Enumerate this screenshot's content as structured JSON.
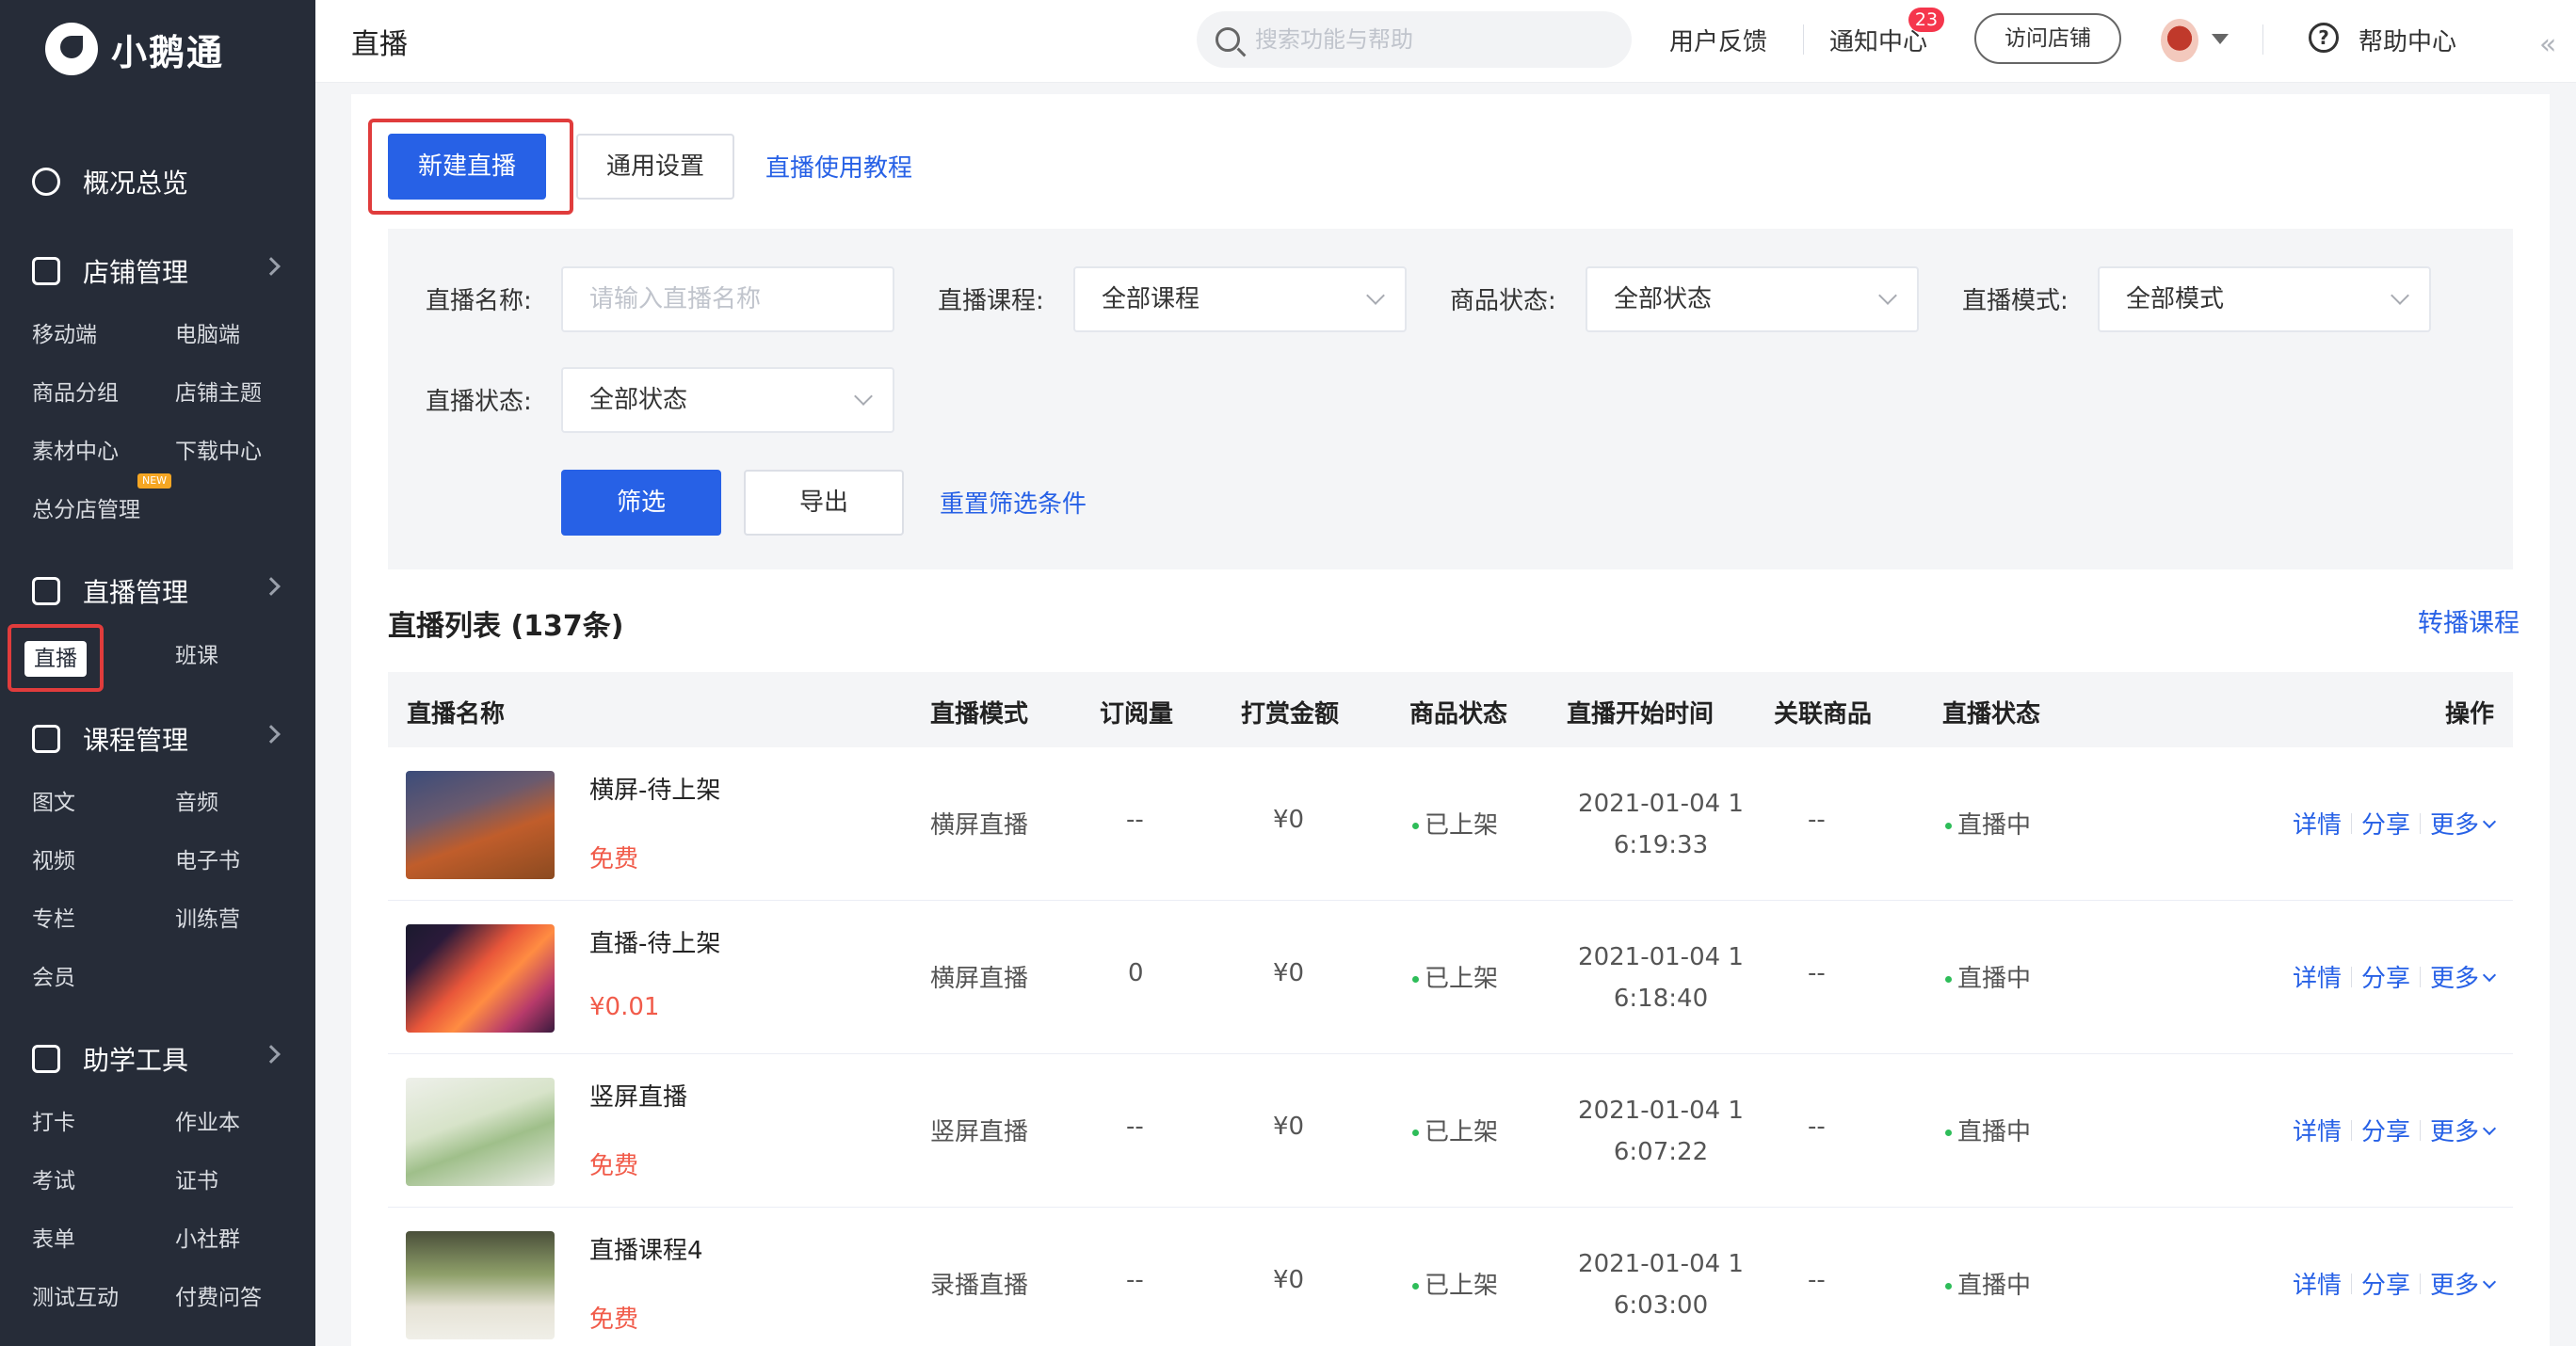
{
  "app": {
    "name": "小鹅通"
  },
  "header": {
    "title": "直播",
    "search_placeholder": "搜索功能与帮助",
    "feedback": "用户反馈",
    "notifications": "通知中心",
    "notification_count": "23",
    "visit_store": "访问店铺",
    "help": "帮助中心"
  },
  "sidebar": {
    "overview": "概况总览",
    "store": {
      "label": "店铺管理",
      "items": [
        "移动端",
        "电脑端",
        "商品分组",
        "店铺主题",
        "素材中心",
        "下载中心",
        "总分店管理"
      ],
      "new_badge": "NEW"
    },
    "live": {
      "label": "直播管理",
      "items": [
        "直播",
        "班课"
      ]
    },
    "course": {
      "label": "课程管理",
      "items": [
        "图文",
        "音频",
        "视频",
        "电子书",
        "专栏",
        "训练营",
        "会员"
      ]
    },
    "tools": {
      "label": "助学工具",
      "items": [
        "打卡",
        "作业本",
        "考试",
        "证书",
        "表单",
        "小社群",
        "测试互动",
        "付费问答"
      ]
    }
  },
  "toolbar": {
    "new_live": "新建直播",
    "settings": "通用设置",
    "tutorial": "直播使用教程"
  },
  "filter": {
    "name_label": "直播名称:",
    "name_placeholder": "请输入直播名称",
    "course_label": "直播课程:",
    "course_value": "全部课程",
    "goods_label": "商品状态:",
    "goods_value": "全部状态",
    "mode_label": "直播模式:",
    "mode_value": "全部模式",
    "status_label": "直播状态:",
    "status_value": "全部状态",
    "filter_btn": "筛选",
    "export_btn": "导出",
    "reset": "重置筛选条件"
  },
  "list": {
    "title": "直播列表 (137条)",
    "rebroadcast": "转播课程",
    "columns": [
      "直播名称",
      "直播模式",
      "订阅量",
      "打赏金额",
      "商品状态",
      "直播开始时间",
      "关联商品",
      "直播状态",
      "操作"
    ],
    "rows": [
      {
        "name": "横屏-待上架",
        "price": "免费",
        "mode": "横屏直播",
        "subs": "--",
        "reward": "¥0",
        "goods": "已上架",
        "time1": "2021-01-04 1",
        "time2": "6:19:33",
        "related": "--",
        "status": "直播中"
      },
      {
        "name": "直播-待上架",
        "price": "¥0.01",
        "mode": "横屏直播",
        "subs": "0",
        "reward": "¥0",
        "goods": "已上架",
        "time1": "2021-01-04 1",
        "time2": "6:18:40",
        "related": "--",
        "status": "直播中"
      },
      {
        "name": "竖屏直播",
        "price": "免费",
        "mode": "竖屏直播",
        "subs": "--",
        "reward": "¥0",
        "goods": "已上架",
        "time1": "2021-01-04 1",
        "time2": "6:07:22",
        "related": "--",
        "status": "直播中"
      },
      {
        "name": "直播课程4",
        "price": "免费",
        "mode": "录播直播",
        "subs": "--",
        "reward": "¥0",
        "goods": "已上架",
        "time1": "2021-01-04 1",
        "time2": "6:03:00",
        "related": "--",
        "status": "直播中"
      }
    ],
    "actions": {
      "detail": "详情",
      "share": "分享",
      "more": "更多"
    }
  }
}
